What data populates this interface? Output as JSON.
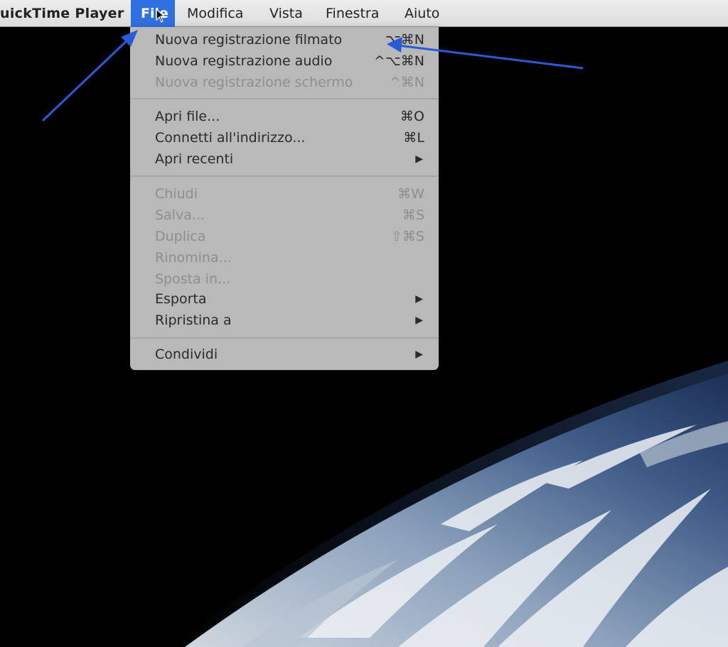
{
  "menubar": {
    "app_name": "uickTime Player",
    "items": [
      "File",
      "Modifica",
      "Vista",
      "Finestra",
      "Aiuto"
    ]
  },
  "file_menu": {
    "groups": [
      [
        {
          "label": "Nuova registrazione filmato",
          "shortcut": "⌥⌘N",
          "enabled": true
        },
        {
          "label": "Nuova registrazione audio",
          "shortcut": "^⌥⌘N",
          "enabled": true
        },
        {
          "label": "Nuova registrazione schermo",
          "shortcut": "^⌘N",
          "enabled": false
        }
      ],
      [
        {
          "label": "Apri file...",
          "shortcut": "⌘O",
          "enabled": true
        },
        {
          "label": "Connetti all'indirizzo...",
          "shortcut": "⌘L",
          "enabled": true
        },
        {
          "label": "Apri recenti",
          "submenu": true,
          "enabled": true
        }
      ],
      [
        {
          "label": "Chiudi",
          "shortcut": "⌘W",
          "enabled": false
        },
        {
          "label": "Salva...",
          "shortcut": "⌘S",
          "enabled": false
        },
        {
          "label": "Duplica",
          "shortcut": "⇧⌘S",
          "enabled": false
        },
        {
          "label": "Rinomina...",
          "enabled": false
        },
        {
          "label": "Sposta in...",
          "enabled": false
        },
        {
          "label": "Esporta",
          "submenu": true,
          "enabled": true
        },
        {
          "label": "Ripristina a",
          "submenu": true,
          "enabled": true
        }
      ],
      [
        {
          "label": "Condividi",
          "submenu": true,
          "enabled": true
        }
      ]
    ]
  },
  "colors": {
    "highlight": "#2f6fe0",
    "annotation_arrow": "#2a5bd7"
  }
}
